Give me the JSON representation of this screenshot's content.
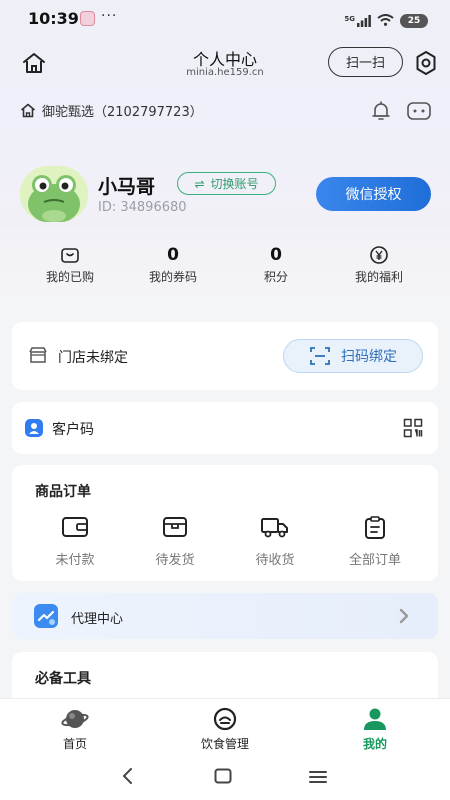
{
  "status_bar": {
    "time": "10:39",
    "dots": "···",
    "network": "5G",
    "battery": "25"
  },
  "header": {
    "title": "个人中心",
    "subtitle": "minia.he159.cn",
    "scan_label": "扫一扫"
  },
  "shop": {
    "name": "御驼甄选（2102797723）"
  },
  "user": {
    "name": "小马哥",
    "switch_label": "切换账号",
    "id": "ID: 34896680",
    "wechat_label": "微信授权"
  },
  "stats": [
    {
      "value": "",
      "label": "我的已购",
      "icon": "bag-icon"
    },
    {
      "value": "0",
      "label": "我的券码"
    },
    {
      "value": "0",
      "label": "积分"
    },
    {
      "value": "",
      "label": "我的福利",
      "icon": "yen-coin-icon"
    }
  ],
  "store": {
    "label": "门店未绑定",
    "bind_label": "扫码绑定"
  },
  "customer_code": {
    "label": "客户码"
  },
  "orders": {
    "title": "商品订单",
    "items": [
      {
        "label": "未付款",
        "icon": "wallet-icon"
      },
      {
        "label": "待发货",
        "icon": "box-icon"
      },
      {
        "label": "待收货",
        "icon": "truck-icon"
      },
      {
        "label": "全部订单",
        "icon": "clipboard-icon"
      }
    ]
  },
  "agent": {
    "label": "代理中心"
  },
  "tools": {
    "title": "必备工具"
  },
  "bottom_nav": [
    {
      "label": "首页",
      "icon": "planet-icon",
      "active": false
    },
    {
      "label": "饮食管理",
      "icon": "dish-icon",
      "active": false
    },
    {
      "label": "我的",
      "icon": "person-icon",
      "active": true
    }
  ],
  "colors": {
    "accent_green": "#18985e",
    "wechat_blue": "#1f6ed8",
    "bind_blue": "#2d6fb8"
  }
}
